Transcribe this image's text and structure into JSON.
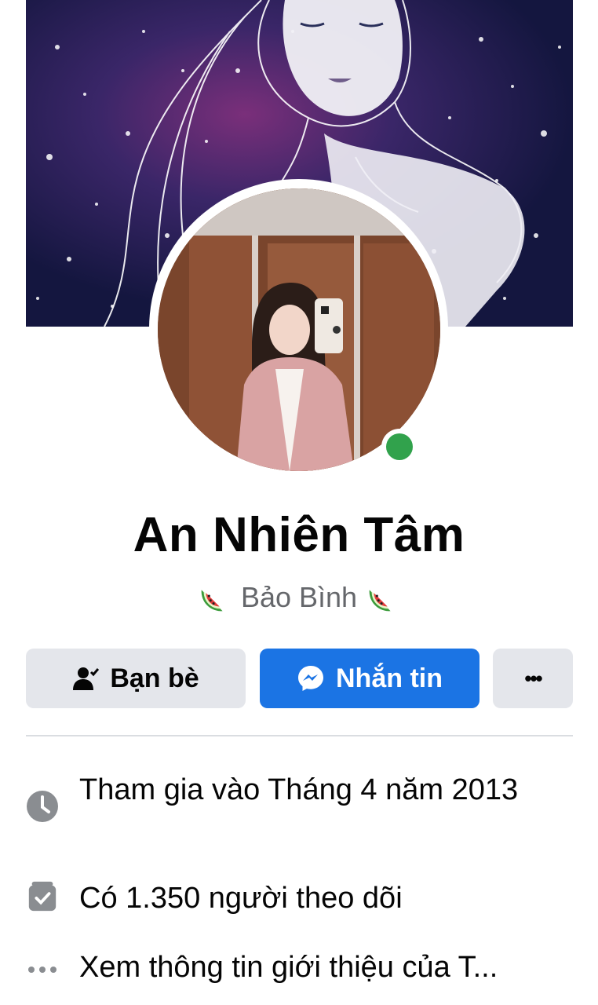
{
  "profile": {
    "name": "An Nhiên Tâm",
    "bio": "Bảo Bình",
    "bio_emoji": "watermelon"
  },
  "actions": {
    "friends_label": "Bạn bè",
    "message_label": "Nhắn tin",
    "more_label": "•••"
  },
  "info": {
    "joined": "Tham gia vào Tháng 4 năm 2013",
    "followers": "Có 1.350 người theo dõi",
    "about": "Xem thông tin giới thiệu của T..."
  },
  "status": {
    "online": true,
    "online_color": "#31a24c"
  },
  "colors": {
    "primary": "#1b74e4",
    "secondary_button": "#e4e6eb",
    "text_primary": "#050505",
    "text_secondary": "#65676b"
  },
  "icons": {
    "friends": "person-check-icon",
    "message": "messenger-icon",
    "more": "more-horizontal-icon",
    "joined": "clock-icon",
    "followers": "followers-card-icon",
    "about": "more-dots-icon"
  }
}
